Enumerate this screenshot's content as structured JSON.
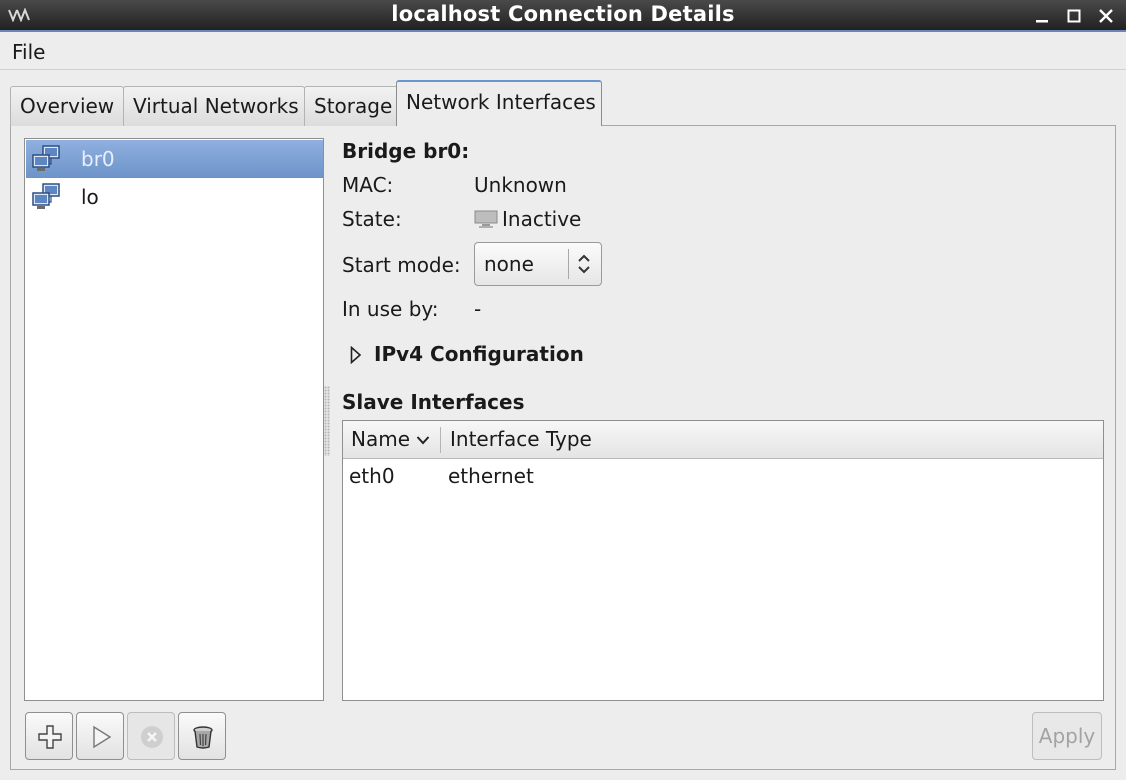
{
  "window": {
    "title": "localhost Connection Details",
    "app_icon": "vm-icon",
    "controls": [
      "minimize",
      "maximize",
      "close"
    ]
  },
  "menubar": {
    "file": "File"
  },
  "tabs": [
    {
      "label": "Overview",
      "active": false
    },
    {
      "label": "Virtual Networks",
      "active": false
    },
    {
      "label": "Storage",
      "active": false
    },
    {
      "label": "Network Interfaces",
      "active": true
    }
  ],
  "interfaces": [
    {
      "label": "br0",
      "icon": "network-interface-icon",
      "selected": true
    },
    {
      "label": "lo",
      "icon": "network-interface-icon",
      "selected": false
    }
  ],
  "details": {
    "heading": "Bridge br0:",
    "mac_label": "MAC:",
    "mac_value": "Unknown",
    "state_label": "State:",
    "state_icon": "monitor-inactive-icon",
    "state_value": "Inactive",
    "start_mode_label": "Start mode:",
    "start_mode_value": "none",
    "in_use_label": "In use by:",
    "in_use_value": "-",
    "ipv4_expander": "IPv4 Configuration",
    "slave_heading": "Slave Interfaces"
  },
  "slave_table": {
    "columns": [
      "Name",
      "Interface Type"
    ],
    "rows": [
      {
        "name": "eth0",
        "type": "ethernet"
      }
    ]
  },
  "buttons": {
    "add": "plus-icon",
    "start": "play-icon",
    "stop": "stop-icon",
    "delete": "trash-icon",
    "apply": "Apply"
  },
  "colors": {
    "selection": "#7b9fd3",
    "titlebar": "#2b2b2b",
    "active_tab_accent": "#6a95d0"
  }
}
